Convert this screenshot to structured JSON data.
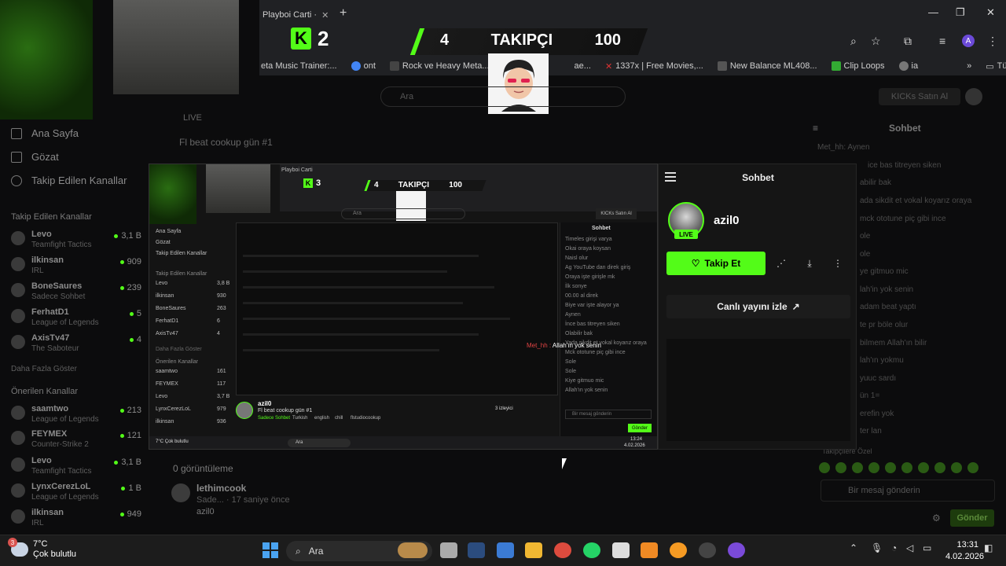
{
  "browser": {
    "tab_title": "Playboi Carti ·",
    "new_tab": "+",
    "window_controls": [
      "—",
      "❐",
      "✕"
    ],
    "profile_initial": "A",
    "bookmarks": [
      {
        "label": "eta Music Trainer:...",
        "color": "#555"
      },
      {
        "label": "ont",
        "color": "#4285f4"
      },
      {
        "label": "Rock ve Heavy Meta...",
        "color": "#333"
      },
      {
        "label": "",
        "color": "#a33"
      },
      {
        "label": "",
        "color": "#777"
      },
      {
        "label": "ae...",
        "color": "#777"
      },
      {
        "label": "1337x | Free Movies,...",
        "color": "#d33"
      },
      {
        "label": "New Balance ML408...",
        "color": "#555"
      },
      {
        "label": "Clip Loops",
        "color": "#3a3"
      },
      {
        "label": "ia",
        "color": "#777"
      }
    ],
    "bookmarks_more": "»",
    "all_bookmarks": "Tüm Yer İşaretleri"
  },
  "overlay": {
    "kick_logo": "K",
    "kick_count": "2",
    "left_count": "4",
    "label": "TAKIPÇI",
    "goal": "100"
  },
  "sidebar": {
    "nav": [
      {
        "label": "Ana Sayfa",
        "icon": "home-icon"
      },
      {
        "label": "Gözat",
        "icon": "browse-icon"
      },
      {
        "label": "Takip Edilen Kanallar",
        "icon": "heart-icon"
      }
    ],
    "followed_title": "Takip Edilen Kanallar",
    "followed": [
      {
        "name": "Levo",
        "game": "Teamfight Tactics",
        "count": "3,1 B"
      },
      {
        "name": "ilkinsan",
        "game": "IRL",
        "count": "909"
      },
      {
        "name": "BoneSaures",
        "game": "Sadece Sohbet",
        "count": "239"
      },
      {
        "name": "FerhatD1",
        "game": "League of Legends",
        "count": "5"
      },
      {
        "name": "AxisTv47",
        "game": "The Saboteur",
        "count": "4"
      }
    ],
    "show_more": "Daha Fazla Göster",
    "recommended_title": "Önerilen Kanallar",
    "recommended": [
      {
        "name": "saamtwo",
        "game": "League of Legends",
        "count": "213"
      },
      {
        "name": "FEYMEX",
        "game": "Counter-Strike 2",
        "count": "121"
      },
      {
        "name": "Levo",
        "game": "Teamfight Tactics",
        "count": "3,1 B"
      },
      {
        "name": "LynxCerezLoL",
        "game": "League of Legends",
        "count": "1 B"
      },
      {
        "name": "ilkinsan",
        "game": "IRL",
        "count": "949"
      }
    ]
  },
  "page": {
    "search_placeholder": "Ara",
    "kicks_button": "KICKs Satın Al",
    "live_label": "LIVE",
    "stream_title": "Fl beat cookup gün #1",
    "chat_title": "Sohbet",
    "chat_lines": [
      "Met_hh: Aynen",
      "ice bas titreyen siken",
      "abilir bak",
      "ada sikdit et vokal koyarız oraya",
      "mck ototune piç gibi ince",
      "ole",
      "ole",
      "ye gitmuo mic",
      "lah'in yok senin",
      "adam beat yaptı",
      "te pr böle olur",
      "bilmem Allah'ın bilir",
      "lah'ın yokmu",
      "yuuc sardı",
      "ün 1=",
      "erefin yok",
      "ter lan"
    ],
    "view_count": "0 görüntüleme",
    "video_channel": "lethimcook",
    "video_sub": "Sade... · 17 saniye önce",
    "video_user": "azil0",
    "message_placeholder": "Bir mesaj gönderin",
    "send_button": "Gönder",
    "followers_label": "Takipçilere Özel"
  },
  "nested": {
    "tab_title": "Playboi Carti",
    "kick_count": "3",
    "left_count": "4",
    "label": "TAKIPÇI",
    "goal": "100",
    "search": "Ara",
    "kicks": "KICKs Satın Al",
    "sidebar": [
      "Ana Sayfa",
      "Gözat",
      "Takip Edilen Kanallar",
      "Takip Edilen Kanallar",
      "Levo",
      "ilkinsan",
      "BoneSaures",
      "FerhatD1",
      "AxisTv47",
      "Daha Fazla Göster",
      "Önerilen Kanallar",
      "saamtwo",
      "FEYMEX",
      "Levo",
      "LynxCerezLoL",
      "ilkinsan"
    ],
    "sidebar_counts": [
      "3,8 B",
      "930",
      "263",
      "6",
      "4",
      "161",
      "117",
      "3,7 B",
      "979",
      "936"
    ],
    "chat_title": "Sohbet",
    "chat_lines": [
      "Timeles girişi varya",
      "Okai oraya koysan",
      "Naisl olur",
      "Ag YouTube dan direk giriş",
      "Oraya işte girişle mk",
      "İlk sonye",
      "00.00 al direk",
      "Biye var işte alayor ya",
      "Aynen",
      "İnce bas titreyen siken",
      "Olabilir bak",
      "Yada sikdit et vokal koyarız oraya",
      "Mck ototune piç gibi ince",
      "Sole",
      "Sole",
      "Kiye gitmuo mic",
      "Allah'ın yok senin"
    ],
    "overlay_user": "Met_hh",
    "overlay_text": "Allah'ın yok senin",
    "stream_user": "azil0",
    "stream_title": "Fl beat cookup gün #1",
    "stream_tags": [
      "Sadece Sohbet",
      "Turkish",
      "english",
      "chill",
      "flstudiocookup"
    ],
    "viewers": "3 izleyici",
    "message_placeholder": "Bir mesaj gönderin",
    "send_button": "Gönder",
    "weather": "7°C Çok bulutlu",
    "clock_time": "13:24",
    "clock_date": "4.02.2026"
  },
  "panel": {
    "title": "Sohbet",
    "username": "azil0",
    "live": "LIVE",
    "follow": "Takip Et",
    "watch": "Canlı yayını izle"
  },
  "taskbar": {
    "weather_badge": "3",
    "temp": "7°C",
    "condition": "Çok bulutlu",
    "search": "Ara",
    "time": "13:31",
    "date": "4.02.2026"
  }
}
